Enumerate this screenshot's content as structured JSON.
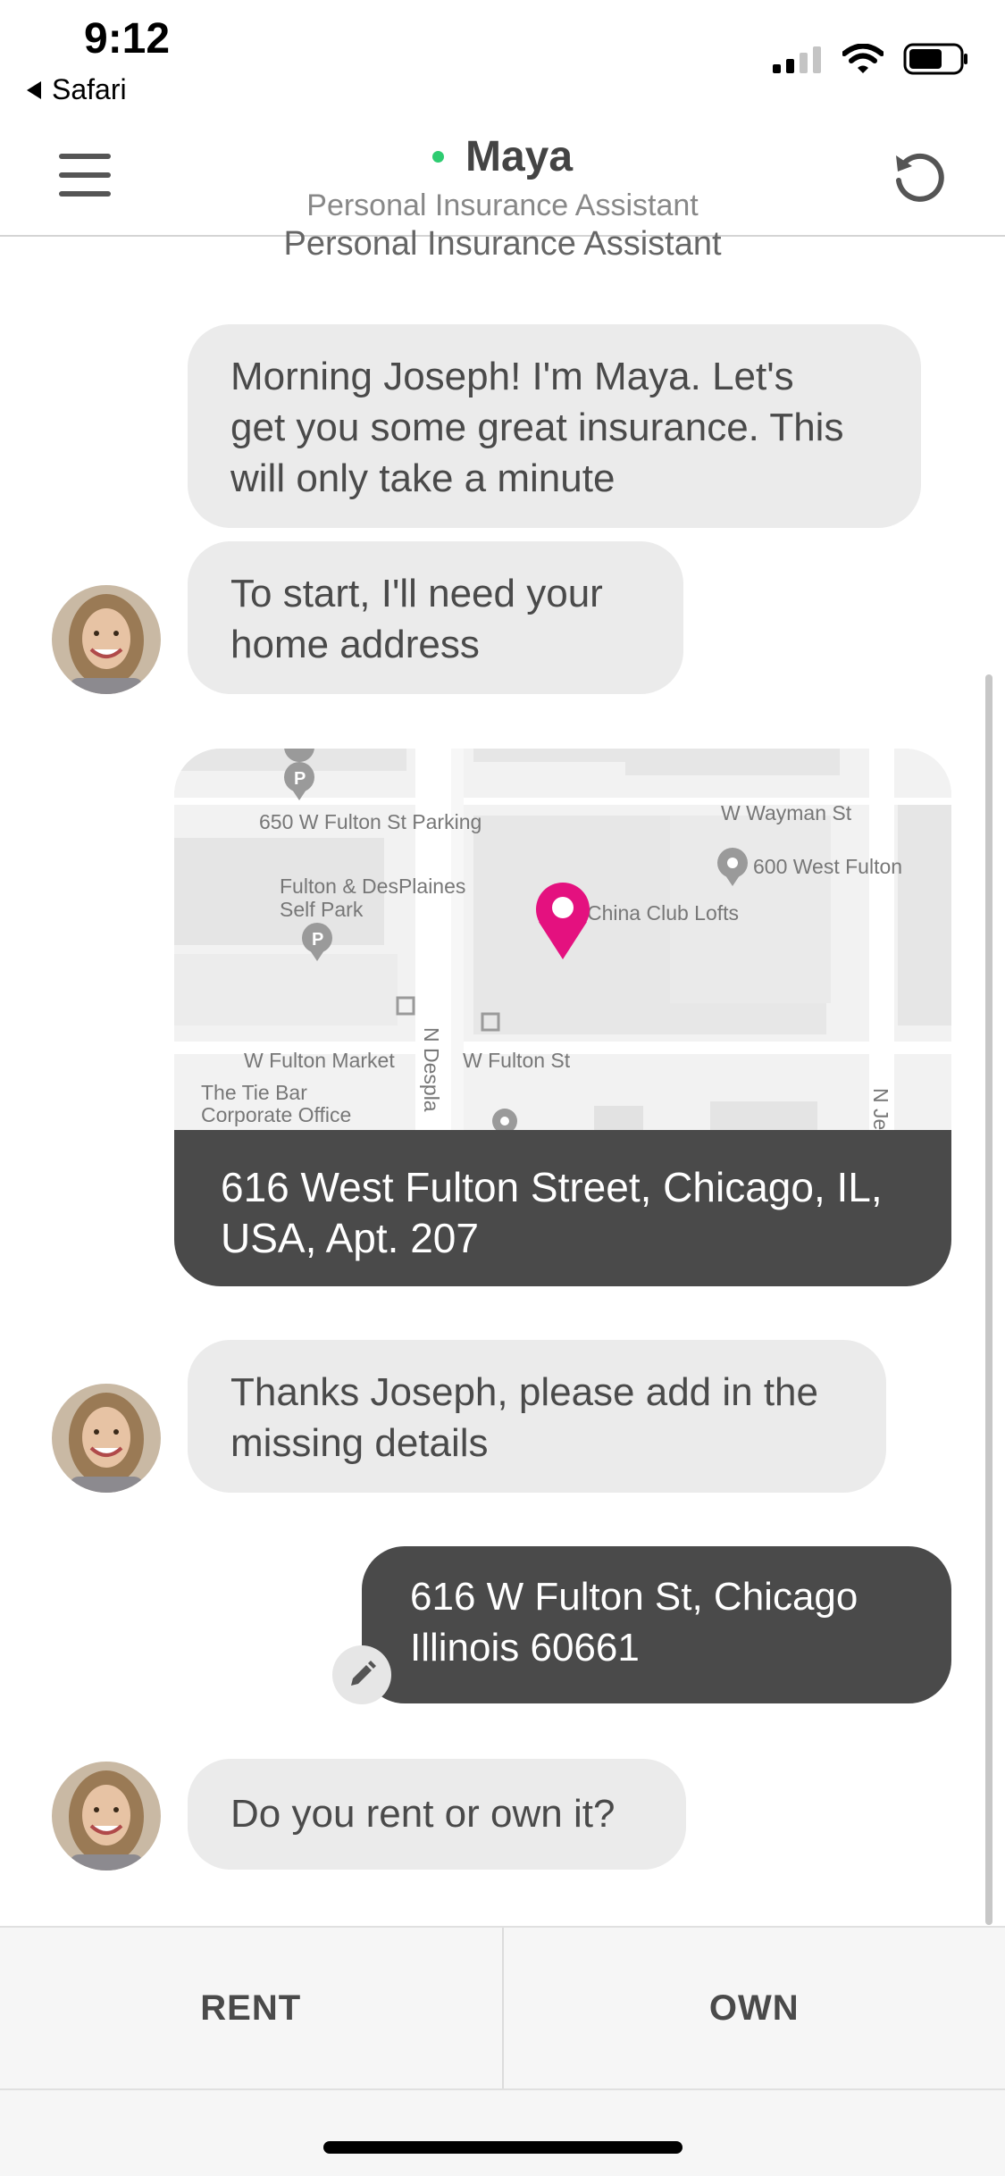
{
  "status_bar": {
    "time": "9:12",
    "back_app": "Safari",
    "signal_icon": "cellular-signal-icon",
    "wifi_icon": "wifi-icon",
    "battery_icon": "battery-icon"
  },
  "header": {
    "name": "Maya",
    "subtitle": "Personal Insurance Assistant",
    "online_color": "#2ecc71",
    "menu_icon": "hamburger-menu-icon",
    "refresh_icon": "refresh-icon"
  },
  "chat": {
    "header_repeat": "Personal Insurance Assistant",
    "messages": [
      {
        "from": "assistant",
        "lines": [
          "Morning Joseph! I'm Maya. Let's",
          "get you some great insurance. This",
          "will only take a minute"
        ]
      },
      {
        "from": "assistant",
        "lines": [
          "To start, I'll need your",
          "home address"
        ]
      },
      {
        "from": "user",
        "type": "map",
        "address_lines": [
          "616 West Fulton Street, Chicago, IL,",
          "USA, Apt. 207"
        ]
      },
      {
        "from": "assistant",
        "lines": [
          "Thanks Joseph, please add in the",
          "missing details"
        ]
      },
      {
        "from": "user",
        "lines": [
          "616 W Fulton St, Chicago",
          "Illinois 60661"
        ]
      },
      {
        "from": "assistant",
        "lines": [
          "Do you rent or own it?"
        ]
      }
    ]
  },
  "map": {
    "labels": {
      "parking": "650 W Fulton St Parking",
      "wayman": "W Wayman St",
      "west_fulton": "600 West Fulton",
      "desplaines_1": "Fulton & DesPlaines",
      "desplaines_2": "Self Park",
      "china_club": "China Club Lofts",
      "fulton_market": "W Fulton Market",
      "fulton_st": "W Fulton St",
      "n_desplaines": "N Despla",
      "tie_bar_1": "The Tie Bar",
      "tie_bar_2": "Corporate Office",
      "n_je": "N Je"
    },
    "pin_color": "#e4117f"
  },
  "choices": {
    "rent": "RENT",
    "own": "OWN"
  }
}
